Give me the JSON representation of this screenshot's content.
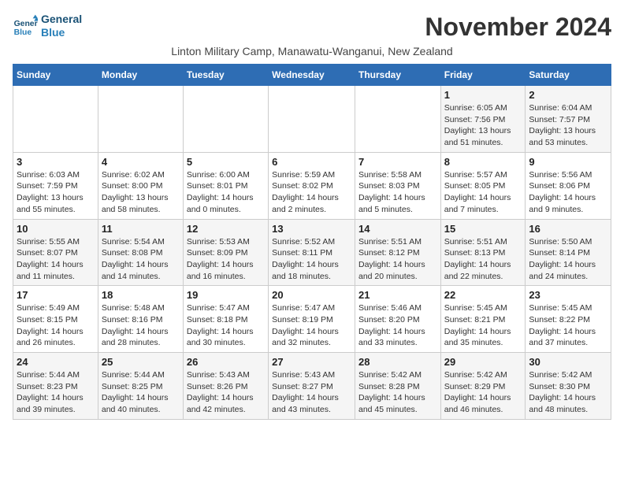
{
  "logo": {
    "line1": "General",
    "line2": "Blue"
  },
  "title": "November 2024",
  "location": "Linton Military Camp, Manawatu-Wanganui, New Zealand",
  "weekdays": [
    "Sunday",
    "Monday",
    "Tuesday",
    "Wednesday",
    "Thursday",
    "Friday",
    "Saturday"
  ],
  "weeks": [
    [
      {
        "day": "",
        "info": ""
      },
      {
        "day": "",
        "info": ""
      },
      {
        "day": "",
        "info": ""
      },
      {
        "day": "",
        "info": ""
      },
      {
        "day": "",
        "info": ""
      },
      {
        "day": "1",
        "info": "Sunrise: 6:05 AM\nSunset: 7:56 PM\nDaylight: 13 hours and 51 minutes."
      },
      {
        "day": "2",
        "info": "Sunrise: 6:04 AM\nSunset: 7:57 PM\nDaylight: 13 hours and 53 minutes."
      }
    ],
    [
      {
        "day": "3",
        "info": "Sunrise: 6:03 AM\nSunset: 7:59 PM\nDaylight: 13 hours and 55 minutes."
      },
      {
        "day": "4",
        "info": "Sunrise: 6:02 AM\nSunset: 8:00 PM\nDaylight: 13 hours and 58 minutes."
      },
      {
        "day": "5",
        "info": "Sunrise: 6:00 AM\nSunset: 8:01 PM\nDaylight: 14 hours and 0 minutes."
      },
      {
        "day": "6",
        "info": "Sunrise: 5:59 AM\nSunset: 8:02 PM\nDaylight: 14 hours and 2 minutes."
      },
      {
        "day": "7",
        "info": "Sunrise: 5:58 AM\nSunset: 8:03 PM\nDaylight: 14 hours and 5 minutes."
      },
      {
        "day": "8",
        "info": "Sunrise: 5:57 AM\nSunset: 8:05 PM\nDaylight: 14 hours and 7 minutes."
      },
      {
        "day": "9",
        "info": "Sunrise: 5:56 AM\nSunset: 8:06 PM\nDaylight: 14 hours and 9 minutes."
      }
    ],
    [
      {
        "day": "10",
        "info": "Sunrise: 5:55 AM\nSunset: 8:07 PM\nDaylight: 14 hours and 11 minutes."
      },
      {
        "day": "11",
        "info": "Sunrise: 5:54 AM\nSunset: 8:08 PM\nDaylight: 14 hours and 14 minutes."
      },
      {
        "day": "12",
        "info": "Sunrise: 5:53 AM\nSunset: 8:09 PM\nDaylight: 14 hours and 16 minutes."
      },
      {
        "day": "13",
        "info": "Sunrise: 5:52 AM\nSunset: 8:11 PM\nDaylight: 14 hours and 18 minutes."
      },
      {
        "day": "14",
        "info": "Sunrise: 5:51 AM\nSunset: 8:12 PM\nDaylight: 14 hours and 20 minutes."
      },
      {
        "day": "15",
        "info": "Sunrise: 5:51 AM\nSunset: 8:13 PM\nDaylight: 14 hours and 22 minutes."
      },
      {
        "day": "16",
        "info": "Sunrise: 5:50 AM\nSunset: 8:14 PM\nDaylight: 14 hours and 24 minutes."
      }
    ],
    [
      {
        "day": "17",
        "info": "Sunrise: 5:49 AM\nSunset: 8:15 PM\nDaylight: 14 hours and 26 minutes."
      },
      {
        "day": "18",
        "info": "Sunrise: 5:48 AM\nSunset: 8:16 PM\nDaylight: 14 hours and 28 minutes."
      },
      {
        "day": "19",
        "info": "Sunrise: 5:47 AM\nSunset: 8:18 PM\nDaylight: 14 hours and 30 minutes."
      },
      {
        "day": "20",
        "info": "Sunrise: 5:47 AM\nSunset: 8:19 PM\nDaylight: 14 hours and 32 minutes."
      },
      {
        "day": "21",
        "info": "Sunrise: 5:46 AM\nSunset: 8:20 PM\nDaylight: 14 hours and 33 minutes."
      },
      {
        "day": "22",
        "info": "Sunrise: 5:45 AM\nSunset: 8:21 PM\nDaylight: 14 hours and 35 minutes."
      },
      {
        "day": "23",
        "info": "Sunrise: 5:45 AM\nSunset: 8:22 PM\nDaylight: 14 hours and 37 minutes."
      }
    ],
    [
      {
        "day": "24",
        "info": "Sunrise: 5:44 AM\nSunset: 8:23 PM\nDaylight: 14 hours and 39 minutes."
      },
      {
        "day": "25",
        "info": "Sunrise: 5:44 AM\nSunset: 8:25 PM\nDaylight: 14 hours and 40 minutes."
      },
      {
        "day": "26",
        "info": "Sunrise: 5:43 AM\nSunset: 8:26 PM\nDaylight: 14 hours and 42 minutes."
      },
      {
        "day": "27",
        "info": "Sunrise: 5:43 AM\nSunset: 8:27 PM\nDaylight: 14 hours and 43 minutes."
      },
      {
        "day": "28",
        "info": "Sunrise: 5:42 AM\nSunset: 8:28 PM\nDaylight: 14 hours and 45 minutes."
      },
      {
        "day": "29",
        "info": "Sunrise: 5:42 AM\nSunset: 8:29 PM\nDaylight: 14 hours and 46 minutes."
      },
      {
        "day": "30",
        "info": "Sunrise: 5:42 AM\nSunset: 8:30 PM\nDaylight: 14 hours and 48 minutes."
      }
    ]
  ]
}
